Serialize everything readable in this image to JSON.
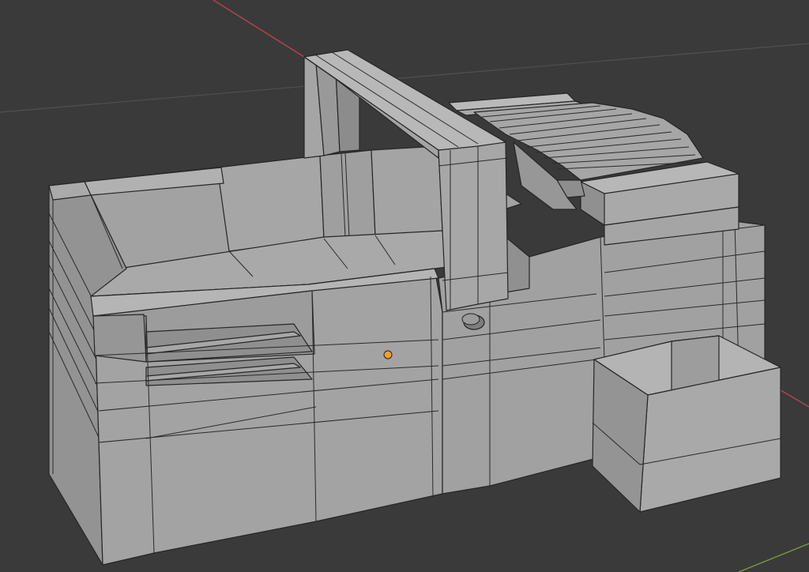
{
  "viewport": {
    "background": "#3a3a3a",
    "grid_color": "#505050",
    "axis_x_color": "#b5444c",
    "axis_y_color": "#7b9a3a",
    "mesh_face_light": "#a3a4a3",
    "mesh_face_mid": "#979897",
    "mesh_face_dark": "#858685",
    "mesh_edge_color": "#262626",
    "origin_point_color": "#f0a030",
    "origin_point_icon": "origin-dot-icon",
    "camera_cylinder_icon": "cylinder-icon"
  }
}
